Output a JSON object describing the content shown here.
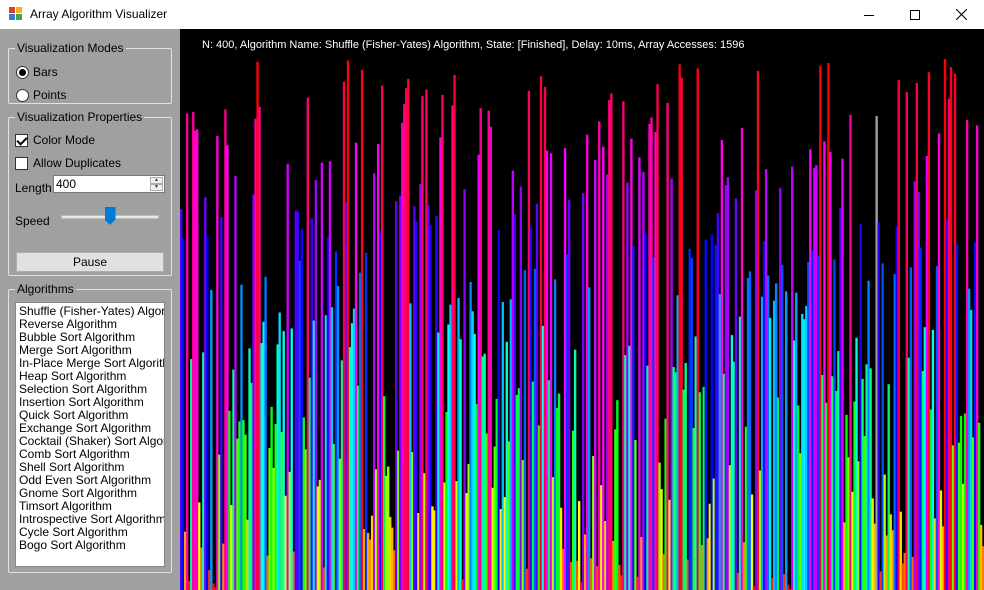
{
  "window": {
    "title": "Array Algorithm Visualizer"
  },
  "icons": {
    "app": "app-icon",
    "minimize": "minimize-icon",
    "maximize": "maximize-icon",
    "close": "close-icon"
  },
  "visualization_modes": {
    "legend": "Visualization Modes",
    "options": [
      {
        "label": "Bars",
        "selected": true
      },
      {
        "label": "Points",
        "selected": false
      }
    ]
  },
  "visualization_properties": {
    "legend": "Visualization Properties",
    "color_mode_label": "Color Mode",
    "color_mode_checked": true,
    "allow_duplicates_label": "Allow Duplicates",
    "allow_duplicates_checked": false,
    "length_label": "Length",
    "length_value": "400",
    "speed_label": "Speed",
    "speed_fraction": 0.5,
    "pause_label": "Pause"
  },
  "algorithms": {
    "legend": "Algorithms",
    "items": [
      "Shuffle (Fisher-Yates) Algorithm",
      "Reverse Algorithm",
      "Bubble Sort Algorithm",
      "Merge Sort Algorithm",
      "In-Place Merge Sort Algorithm",
      "Heap Sort Algorithm",
      "Selection Sort Algorithm",
      "Insertion Sort Algorithm",
      "Quick Sort Algorithm",
      "Exchange Sort Algorithm",
      "Cocktail (Shaker) Sort Algorithm",
      "Comb Sort Algorithm",
      "Shell Sort Algorithm",
      "Odd Even Sort Algorithm",
      "Gnome Sort Algorithm",
      "Timsort Algorithm",
      "Introspective Sort Algorithm",
      "Cycle Sort Algorithm",
      "Bogo Sort Algorithm"
    ]
  },
  "status_text": "N: 400, Algorithm Name: Shuffle (Fisher-Yates) Algorithm, State: [Finished], Delay: 10ms, Array Accesses: 1596",
  "visualization": {
    "n": 400,
    "seed": 20240,
    "background": "#000000",
    "highlight_color": "#a0a0a0",
    "highlight_value": 357
  }
}
